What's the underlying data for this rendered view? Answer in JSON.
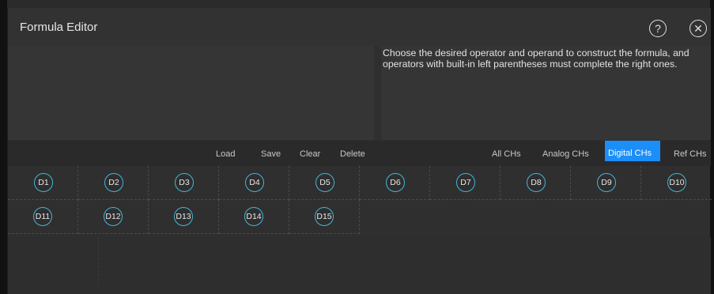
{
  "dialog": {
    "title": "Formula Editor",
    "help_icon": "help-circle-icon",
    "close_icon": "close-circle-icon",
    "help_glyph": "?",
    "close_glyph": "✕"
  },
  "hint": {
    "text": "Choose the desired operator and operand to construct the formula, and operators with built-in left parentheses must complete the right ones."
  },
  "toolbar": {
    "load": "Load",
    "save": "Save",
    "clear": "Clear",
    "delete": "Delete"
  },
  "tabs": {
    "all": "All CHs",
    "analog": "Analog CHs",
    "digital": "Digital CHs",
    "ref": "Ref CHs",
    "active": "Digital CHs"
  },
  "channels": {
    "row1": [
      "D1",
      "D2",
      "D3",
      "D4",
      "D5",
      "D6",
      "D7",
      "D8",
      "D9",
      "D10"
    ],
    "row2": [
      "D11",
      "D12",
      "D13",
      "D14",
      "D15"
    ]
  },
  "colors": {
    "accent": "#1b8ef7",
    "channel_ring": "#44b7d6"
  }
}
